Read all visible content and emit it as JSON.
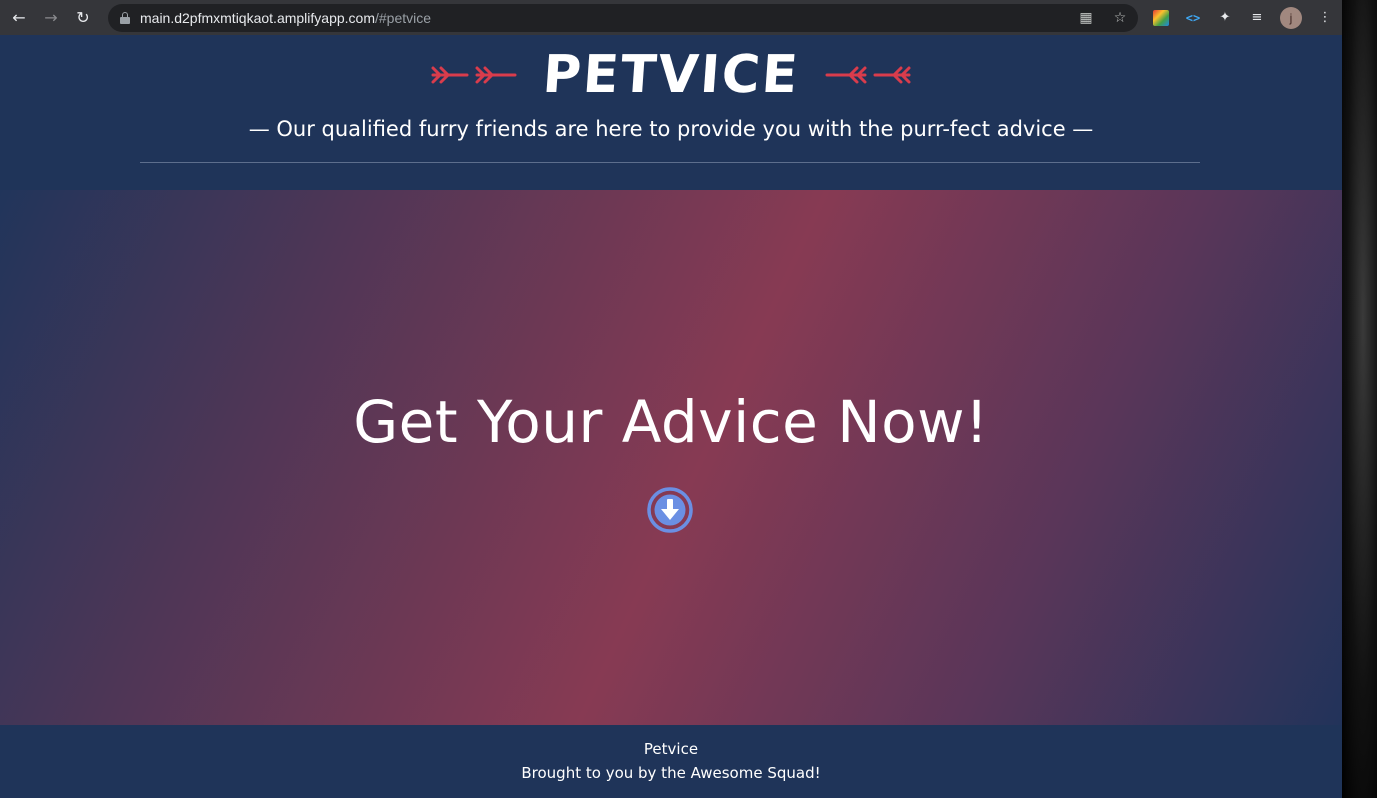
{
  "browser": {
    "url_host": "main.d2pfmxmtiqkaot.amplifyapp.com",
    "url_path": "/#petvice",
    "avatar_initial": "j"
  },
  "colors": {
    "accent_arrow": "#d93c4c",
    "header_bg": "#1f3459",
    "hero_center": "#873a53",
    "down_button": "#6b8fe3"
  },
  "header": {
    "title": "PETVICE",
    "tagline": "— Our qualified furry friends are here to provide you with the purr-fect advice —"
  },
  "hero": {
    "title": "Get Your Advice Now!",
    "button_icon": "arrow-down-circle-icon"
  },
  "footer": {
    "line1": "Petvice",
    "line2": "Brought to you by the Awesome Squad!"
  }
}
